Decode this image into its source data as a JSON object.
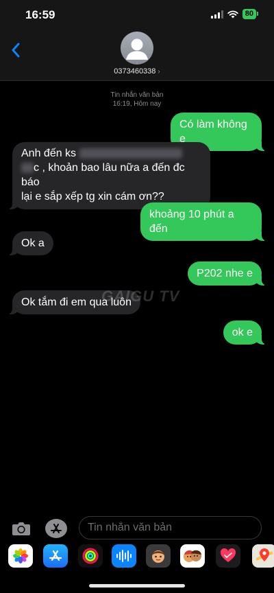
{
  "status_bar": {
    "time": "16:59",
    "battery": "80"
  },
  "header": {
    "contact_number": "0373460338",
    "chevron": "›"
  },
  "thread": {
    "meta_line1": "Tin nhắn văn bản",
    "meta_line2": "16:19, Hôm nay",
    "messages": [
      {
        "direction": "outgoing",
        "text": "Có làm không e"
      },
      {
        "direction": "incoming",
        "line1_visible": "Anh đến ks",
        "line2_visible": "c , khoản bao lâu nữa a đến đc báo",
        "line3": "lại e sắp xếp tg xin cám ơn??"
      },
      {
        "direction": "outgoing",
        "text": "khoảng 10 phút a đến"
      },
      {
        "direction": "incoming",
        "text": "Ok a"
      },
      {
        "direction": "outgoing",
        "text": "P202 nhe e"
      },
      {
        "direction": "incoming",
        "text": "Ok tắm đi em qua luôn"
      },
      {
        "direction": "outgoing",
        "text": "ok e"
      }
    ]
  },
  "watermark": "GAIGU TV",
  "composer": {
    "placeholder": "Tin nhắn văn bản"
  },
  "app_drawer": {
    "apps": [
      "photos-icon",
      "app-store-icon",
      "activity-icon",
      "audio-message-icon",
      "memoji-icon",
      "memoji-stickers-icon",
      "digital-touch-icon",
      "maps-icon"
    ]
  },
  "colors": {
    "outgoing_bubble": "#34c759",
    "incoming_bubble": "#262629",
    "accent": "#0a84ff"
  }
}
